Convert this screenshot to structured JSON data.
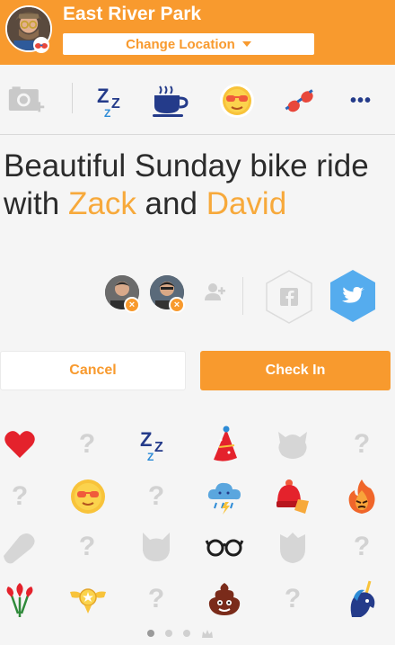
{
  "header": {
    "title": "East River Park",
    "change_location_label": "Change Location"
  },
  "toolbar": {
    "icons": [
      "add-photo-icon",
      "sleep-zzz-icon",
      "coffee-cup-icon",
      "sun-sunglasses-icon",
      "sunglasses-icon",
      "more-icon"
    ],
    "more_label": "•••"
  },
  "post": {
    "text_start": "Beautiful Sunday bike ride with ",
    "friend1": "Zack",
    "joiner": " and ",
    "friend2": "David"
  },
  "friends_row": {
    "remove_symbol": "×"
  },
  "actions": {
    "cancel_label": "Cancel",
    "checkin_label": "Check In"
  },
  "sticker_grid": {
    "unknown_symbol": "?",
    "rows": [
      [
        "heart",
        "unknown",
        "sleep-zzz",
        "party-hat",
        "locked-silhouette",
        "unknown"
      ],
      [
        "unknown",
        "sun-sunglasses",
        "unknown",
        "rain-cloud",
        "beanie-hat",
        "angry-flame"
      ],
      [
        "locked-silhouette",
        "unknown",
        "locked-silhouette",
        "glasses",
        "locked-silhouette",
        "unknown"
      ],
      [
        "flowers",
        "badge-wings",
        "unknown",
        "poop",
        "unknown",
        "unicorn"
      ]
    ]
  },
  "pager": {
    "pages": 4,
    "active_index": 0
  },
  "colors": {
    "brand_orange": "#f89a2e",
    "highlight": "#f7a93b",
    "twitter_blue": "#55acee"
  }
}
